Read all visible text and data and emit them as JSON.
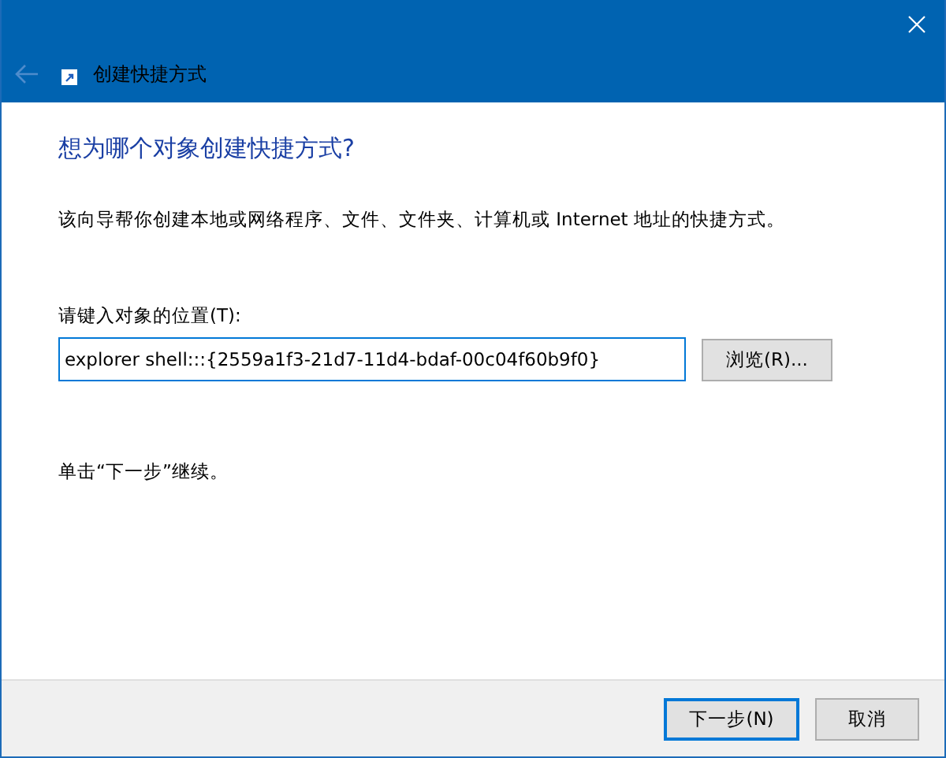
{
  "window": {
    "title": "创建快捷方式"
  },
  "heading": "想为哪个对象创建快捷方式?",
  "description": "该向导帮你创建本地或网络程序、文件、文件夹、计算机或 Internet 地址的快捷方式。",
  "location": {
    "label": "请键入对象的位置(T):",
    "value": "explorer shell:::{2559a1f3-21d7-11d4-bdaf-00c04f60b9f0}",
    "browse_button": "浏览(R)..."
  },
  "hint": "单击“下一步”继续。",
  "buttons": [
    {
      "label": "下一步(N)",
      "default": true
    },
    {
      "label": "取消",
      "default": false
    }
  ]
}
